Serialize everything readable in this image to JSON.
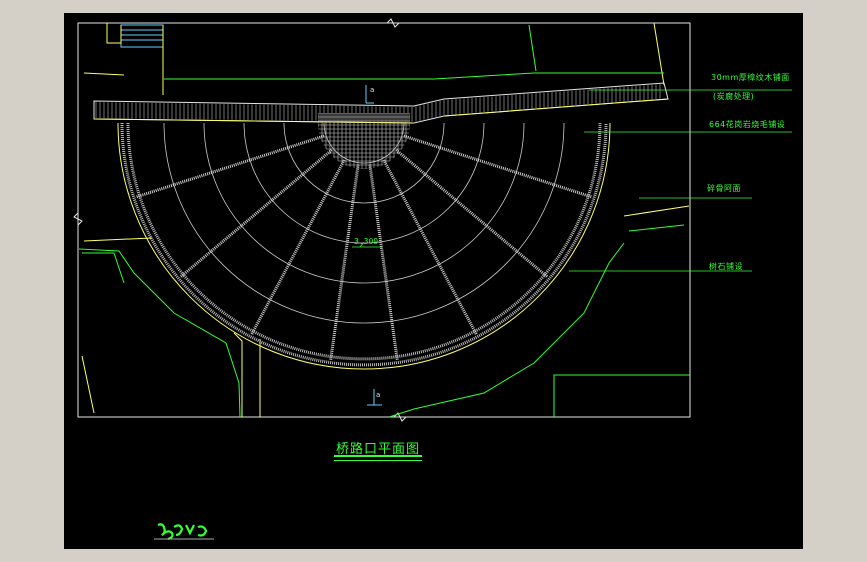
{
  "drawing": {
    "title": "桥路口平面图",
    "elevation_mark": "3.300",
    "annotations": [
      {
        "id": "anno-1",
        "line1": "30mm厚樟纹木铺面",
        "line2": "(炭腐处理)"
      },
      {
        "id": "anno-2",
        "line1": "664花岗岩烧毛铺设"
      },
      {
        "id": "anno-3",
        "line1": "碎骨阿面"
      },
      {
        "id": "anno-4",
        "line1": "树石铺设"
      }
    ],
    "section_marks": [
      "a",
      "a"
    ]
  },
  "colors": {
    "background": "#000000",
    "line_green": "#33ff33",
    "line_yellow": "#ffff66",
    "line_white": "#e6e6e6",
    "line_cyan": "#66ccff",
    "frame_gray": "#d4d0c8"
  }
}
